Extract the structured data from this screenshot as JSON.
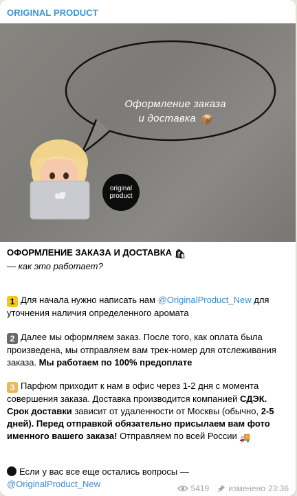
{
  "channel": {
    "name": "ORIGINAL PRODUCT",
    "accent": "#3a93d0"
  },
  "photo": {
    "speech_text_line1": "Оформление заказа",
    "speech_text_line2": "и доставка",
    "logo_line1": "original",
    "logo_line2": "product"
  },
  "post": {
    "title": "ОФОРМЛЕНИЕ ЗАКАЗА И ДОСТАВКА",
    "subtitle": "— как это работает?",
    "step1_num": "1",
    "step1_text_a": "Для начала нужно написать нам ",
    "step1_link": "@OriginalProduct_New",
    "step1_text_b": " для уточнения наличия определенного аромата",
    "step2_num": "2",
    "step2_text_a": "Далее мы оформляем заказ. После того, как оплата была произведена, мы отправляем вам трек-номер для отслеживания заказа. ",
    "step2_bold": "Мы работаем по 100% предоплате",
    "step3_num": "3",
    "step3_text_a": "Парфюм приходит к нам в офис через 1-2 дня с момента совершения заказа. Доставка производится компанией ",
    "step3_bold_a": "СДЭК.",
    "step3_bold_b": "Срок доставки",
    "step3_text_b": " зависит от удаленности от Москвы (обычно, ",
    "step3_bold_c": "2-5 дней).",
    "step3_bold_d": " Перед отправкой обязательно присылаем вам фото именного вашего заказа!",
    "step3_text_c": " Отправляем по всей России",
    "questions_text": "Если у вас все еще остались вопросы —",
    "questions_link": "@OriginalProduct_New"
  },
  "meta": {
    "views": "5419",
    "edited_label": "изменено",
    "time": "23:36"
  }
}
